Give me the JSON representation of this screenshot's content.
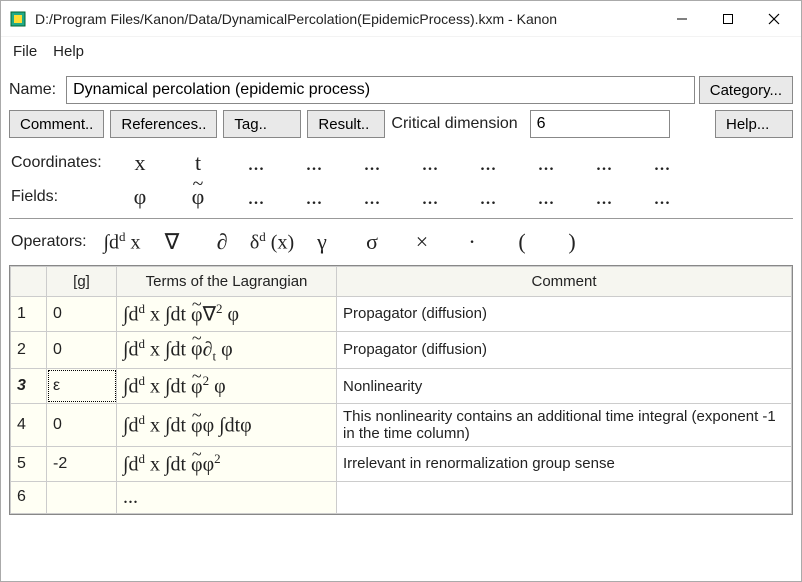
{
  "window": {
    "title": "D:/Program Files/Kanon/Data/DynamicalPercolation(EpidemicProcess).kxm - Kanon"
  },
  "menu": {
    "file": "File",
    "help": "Help"
  },
  "nameRow": {
    "label": "Name:",
    "value": "Dynamical percolation (epidemic process)"
  },
  "buttons": {
    "category": "Category...",
    "comment": "Comment..",
    "references": "References..",
    "tag": "Tag..",
    "result": "Result..",
    "critdim_label": "Critical dimension",
    "critdim_value": "6",
    "help": "Help..."
  },
  "coord": {
    "label": "Coordinates:",
    "items": [
      "x",
      "t",
      "...",
      "...",
      "...",
      "...",
      "...",
      "...",
      "...",
      "..."
    ]
  },
  "fields": {
    "label": "Fields:",
    "items": [
      "φ",
      "φ̃",
      "...",
      "...",
      "...",
      "...",
      "...",
      "...",
      "...",
      "..."
    ]
  },
  "ops": {
    "label": "Operators:",
    "items": [
      "∫dᵈ x",
      "∇",
      "∂",
      "δᵈ (x)",
      "γ",
      "σ",
      "×",
      "·",
      "(",
      ")"
    ]
  },
  "table": {
    "headers": [
      "",
      "[g]",
      "Terms of the Lagrangian",
      "Comment"
    ],
    "rows": [
      {
        "n": "1",
        "g": "0",
        "term": "∫dᵈ x ∫dt φ̃∇² φ",
        "comment": "Propagator (diffusion)"
      },
      {
        "n": "2",
        "g": "0",
        "term": "∫dᵈ x ∫dt φ̃∂ₜ φ",
        "comment": "Propagator (diffusion)"
      },
      {
        "n": "3",
        "g": "ε",
        "term": "∫dᵈ x ∫dt φ̃² φ",
        "comment": "Nonlinearity",
        "sel": true
      },
      {
        "n": "4",
        "g": "0",
        "term": "∫dᵈ x ∫dt φ̃φ ∫dtφ",
        "comment": "This nonlinearity contains an additional time integral (exponent -1 in the time column)"
      },
      {
        "n": "5",
        "g": "-2",
        "term": "∫dᵈ x ∫dt φ̃φ²",
        "comment": "Irrelevant in renormalization group sense"
      },
      {
        "n": "6",
        "g": "",
        "term": "...",
        "comment": ""
      }
    ]
  }
}
